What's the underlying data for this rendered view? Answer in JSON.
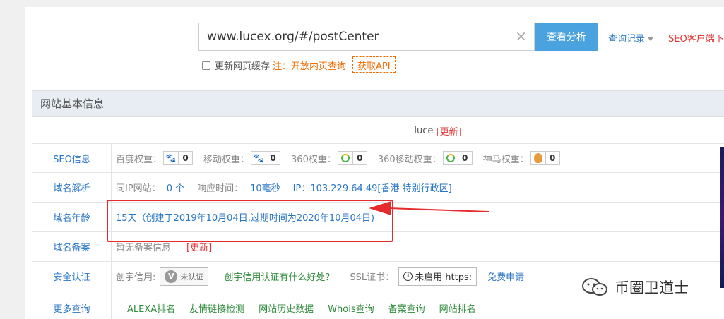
{
  "search": {
    "value": "www.lucex.org/#/postCenter",
    "clear_symbol": "×",
    "button_label": "查看分析",
    "history_label": "查询记录",
    "seo_client_label": "SEO客户端下载"
  },
  "options": {
    "cache_label": "更新网页缓存",
    "note_label": "注：开放内页查询",
    "api_label": "获取API"
  },
  "panel": {
    "title": "网站基本信息",
    "site_title": "luce",
    "refresh_label": "[更新]"
  },
  "seo_row": {
    "label": "SEO信息",
    "items": [
      {
        "name": "百度权重：",
        "icon": "baidu-paw-icon",
        "value": "0"
      },
      {
        "name": "移动权重：",
        "icon": "baidu-paw-icon",
        "value": "0"
      },
      {
        "name": "360权重：",
        "icon": "360-ring-icon",
        "value": "0"
      },
      {
        "name": "360移动权重：",
        "icon": "360-ring-icon",
        "value": "0"
      },
      {
        "name": "神马权重：",
        "icon": "shenma-horse-icon",
        "value": "0"
      }
    ]
  },
  "dns_row": {
    "label": "域名解析",
    "same_ip_label": "同IP网站：",
    "same_ip_value": "0 个",
    "response_label": "响应时间：",
    "response_value": "10毫秒",
    "ip_text": "IP：103.229.64.49[香港 特别行政区]"
  },
  "age_row": {
    "label": "域名年龄",
    "value": "15天（创建于2019年10月04日,过期时间为2020年10月04日)"
  },
  "icp_row": {
    "label": "域名备案",
    "value": "暂无备案信息",
    "refresh_label": "[更新]"
  },
  "security_row": {
    "label": "安全认证",
    "credit_label": "创宇信用:",
    "credit_badge_text": "未认证",
    "credit_badge_symbol": "V",
    "credit_link": "创宇信用认证有什么好处？",
    "ssl_label": "SSL证书：",
    "ssl_info_symbol": "i",
    "ssl_badge_text": "未启用 https:",
    "ssl_apply_link": "免费申请"
  },
  "more_row": {
    "label": "更多查询",
    "links": [
      "ALEXA排名",
      "友情链接检测",
      "网站历史数据",
      "Whois查询",
      "备案查询",
      "网站排名"
    ]
  },
  "watermark": {
    "text": "币圈卫道士"
  },
  "colors": {
    "accent_blue": "#4aa3df",
    "link_blue": "#2a76c6",
    "red": "#e53333",
    "orange": "#f06a00",
    "green": "#2e8b3a",
    "annotation_red": "#e52b2b"
  }
}
